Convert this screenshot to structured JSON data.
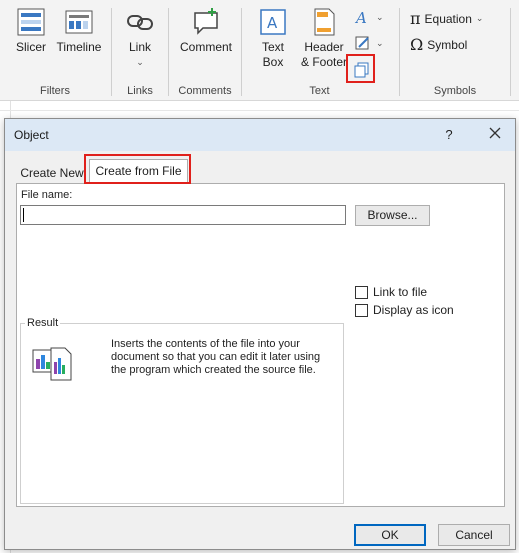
{
  "ribbon": {
    "filters": {
      "label": "Filters",
      "slicer": "Slicer",
      "timeline": "Timeline"
    },
    "links": {
      "label": "Links",
      "link": "Link"
    },
    "comments": {
      "label": "Comments",
      "comment": "Comment"
    },
    "text": {
      "label": "Text",
      "text_box_line1": "Text",
      "text_box_line2": "Box",
      "header_line1": "Header",
      "header_line2": "& Footer"
    },
    "symbols": {
      "label": "Symbols",
      "equation": "Equation",
      "symbol": "Symbol"
    }
  },
  "dialog": {
    "title": "Object",
    "help": "?",
    "tabs": [
      "Create New",
      "Create from File"
    ],
    "file_name_label": "File name:",
    "file_name_value": "",
    "browse": "Browse...",
    "link_to_file": "Link to file",
    "display_as_icon": "Display as icon",
    "result_label": "Result",
    "result_text": "Inserts the contents of the file into your document so that you can edit it later using the program which created the source file.",
    "ok": "OK",
    "cancel": "Cancel"
  },
  "colors": {
    "highlight": "#e0201b",
    "accent": "#0067c0"
  }
}
